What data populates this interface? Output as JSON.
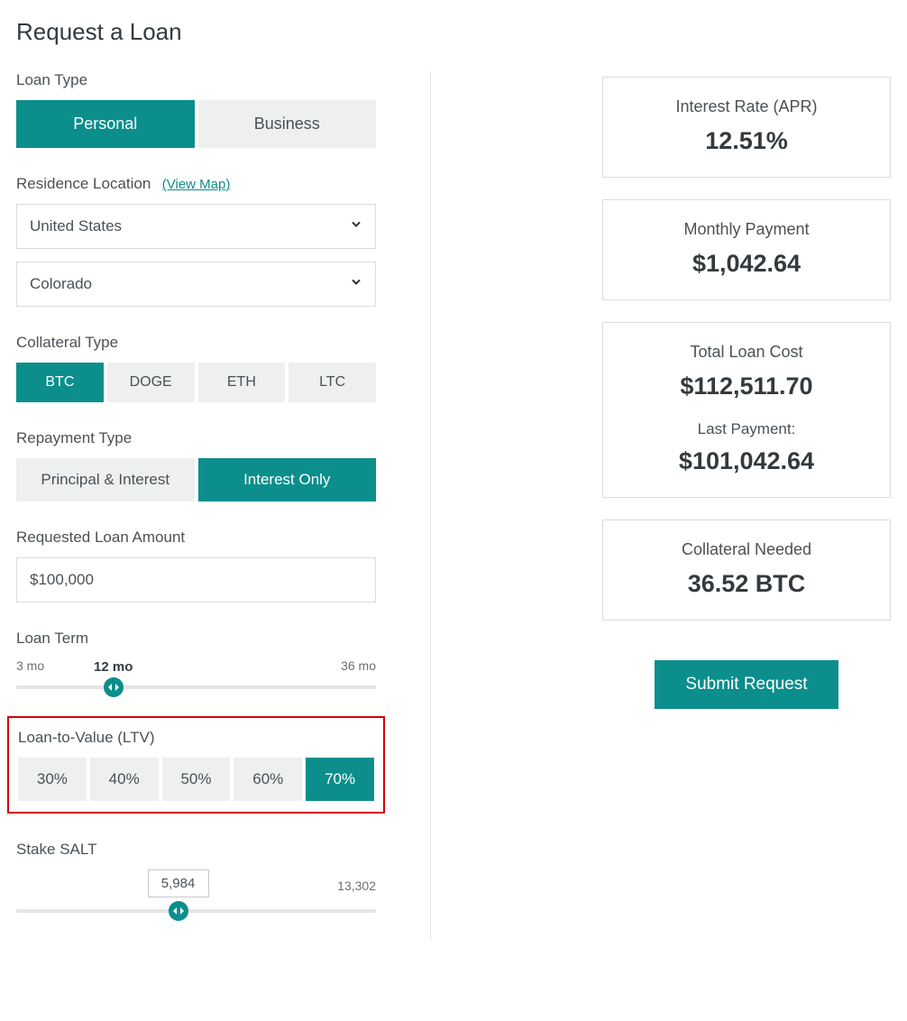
{
  "page_title": "Request a Loan",
  "loan_type": {
    "label": "Loan Type",
    "options": [
      "Personal",
      "Business"
    ],
    "selected": "Personal"
  },
  "residence": {
    "label": "Residence Location",
    "view_map": "(View Map)",
    "country": "United States",
    "state": "Colorado"
  },
  "collateral_type": {
    "label": "Collateral Type",
    "options": [
      "BTC",
      "DOGE",
      "ETH",
      "LTC"
    ],
    "selected": "BTC"
  },
  "repayment_type": {
    "label": "Repayment Type",
    "options": [
      "Principal & Interest",
      "Interest Only"
    ],
    "selected": "Interest Only"
  },
  "requested_amount": {
    "label": "Requested Loan Amount",
    "value": "$100,000"
  },
  "loan_term": {
    "label": "Loan Term",
    "min_label": "3 mo",
    "max_label": "36 mo",
    "current_label": "12 mo",
    "percent": 27
  },
  "ltv": {
    "label": "Loan-to-Value (LTV)",
    "options": [
      "30%",
      "40%",
      "50%",
      "60%",
      "70%"
    ],
    "selected": "70%"
  },
  "stake": {
    "label": "Stake SALT",
    "value": "5,984",
    "max_label": "13,302",
    "percent": 45
  },
  "summary": {
    "interest_rate": {
      "label": "Interest Rate (APR)",
      "value": "12.51%"
    },
    "monthly_payment": {
      "label": "Monthly Payment",
      "value": "$1,042.64"
    },
    "total_cost": {
      "label": "Total Loan Cost",
      "value": "$112,511.70",
      "last_payment_label": "Last Payment:",
      "last_payment_value": "$101,042.64"
    },
    "collateral_needed": {
      "label": "Collateral Needed",
      "value": "36.52 BTC"
    },
    "submit": "Submit Request"
  }
}
